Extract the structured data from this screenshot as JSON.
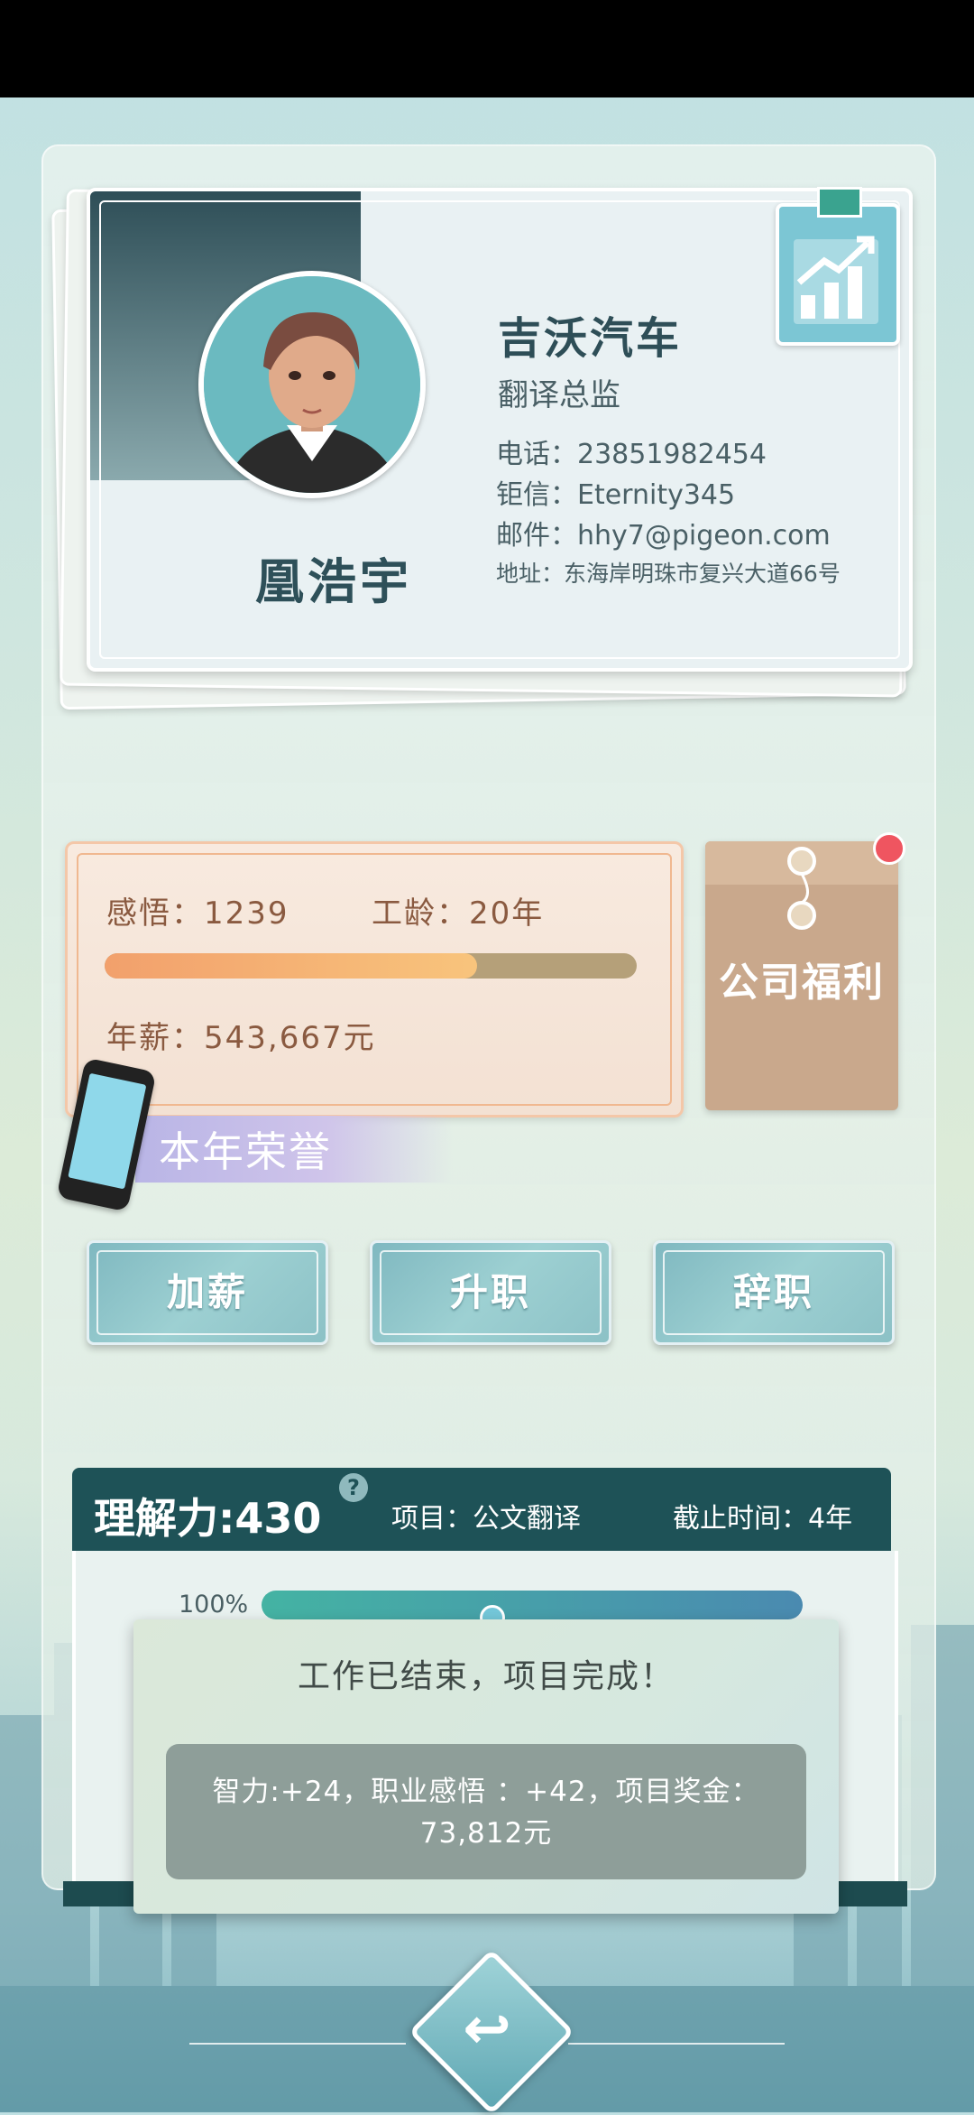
{
  "card": {
    "name": "凰浩宇",
    "company": "吉沃汽车",
    "title": "翻译总监",
    "phone": "电话：23851982454",
    "chat": "钜信：Eternity345",
    "email": "邮件：hhy7@pigeon.com",
    "address": "地址：东海岸明珠市复兴大道66号"
  },
  "stats": {
    "insight": "感悟：1239",
    "seniority": "工龄：20年",
    "salary": "年薪：543,667元",
    "insight_progress": 0.7
  },
  "welfare": {
    "label": "公司福利",
    "has_notification": true
  },
  "honor": {
    "label": "本年荣誉"
  },
  "actions": {
    "raise": "加薪",
    "promote": "升职",
    "resign": "辞职"
  },
  "project": {
    "comprehension": "理解力:430",
    "help": "?",
    "item": "项目：公文翻译",
    "deadline": "截止时间：4年",
    "progress_text": "100%",
    "progress": 1.0
  },
  "popup": {
    "title": "工作已结束，项目完成！",
    "reward_line1": "智力:+24，职业感悟 ：+42，项目奖金：",
    "reward_line2": "73,812元"
  },
  "back": {
    "icon": "return-arrow-icon"
  },
  "colors": {
    "accent": "#1e5257",
    "stat_text": "#8a5a40",
    "button": "#8cc1c6",
    "notification": "#ef5560"
  }
}
